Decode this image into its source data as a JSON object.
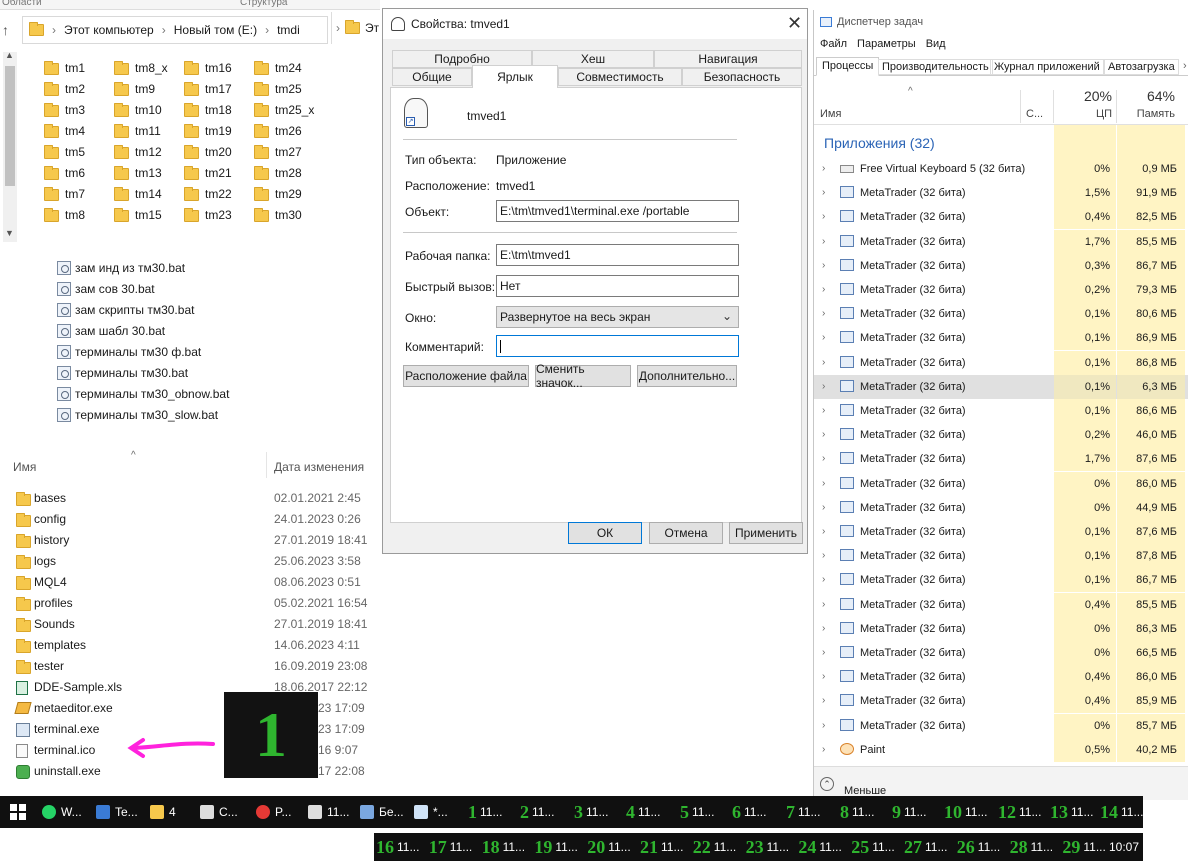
{
  "explorer": {
    "top_labels": [
      "Области",
      "Структура"
    ],
    "breadcrumb": [
      "Этот компьютер",
      "Новый том (E:)",
      "tmdi"
    ],
    "folders": [
      [
        "tm1",
        "tm8_x",
        "tm16",
        "tm24"
      ],
      [
        "tm2",
        "tm9",
        "tm17",
        "tm25"
      ],
      [
        "tm3",
        "tm10",
        "tm18",
        "tm25_x"
      ],
      [
        "tm4",
        "tm11",
        "tm19",
        "tm26"
      ],
      [
        "tm5",
        "tm12",
        "tm20",
        "tm27"
      ],
      [
        "tm6",
        "tm13",
        "tm21",
        "tm28"
      ],
      [
        "tm7",
        "tm14",
        "tm22",
        "tm29"
      ],
      [
        "tm8",
        "tm15",
        "tm23",
        "tm30"
      ]
    ],
    "bat_files": [
      "зам  инд из тм30.bat",
      "зам  сов 30.bat",
      "зам скрипты тм30.bat",
      "зам шабл 30.bat",
      "терминалы тм30 ф.bat",
      "терминалы тм30.bat",
      "терминалы тм30_obnow.bat",
      "терминалы тм30_slow.bat"
    ],
    "list_header": {
      "name": "Имя",
      "date": "Дата изменения"
    },
    "files": [
      {
        "name": "bases",
        "date": "02.01.2021 2:45",
        "kind": "folder"
      },
      {
        "name": "config",
        "date": "24.01.2023 0:26",
        "kind": "folder"
      },
      {
        "name": "history",
        "date": "27.01.2019 18:41",
        "kind": "folder"
      },
      {
        "name": "logs",
        "date": "25.06.2023 3:58",
        "kind": "folder"
      },
      {
        "name": "MQL4",
        "date": "08.06.2023 0:51",
        "kind": "folder"
      },
      {
        "name": "profiles",
        "date": "05.02.2021 16:54",
        "kind": "folder"
      },
      {
        "name": "Sounds",
        "date": "27.01.2019 18:41",
        "kind": "folder"
      },
      {
        "name": "templates",
        "date": "14.06.2023 4:11",
        "kind": "folder"
      },
      {
        "name": "tester",
        "date": "16.09.2019 23:08",
        "kind": "folder"
      },
      {
        "name": "DDE-Sample.xls",
        "date": "18.06.2017 22:12",
        "kind": "xls"
      },
      {
        "name": "metaeditor.exe",
        "date": "23 17:09",
        "kind": "me"
      },
      {
        "name": "terminal.exe",
        "date": "23 17:09",
        "kind": "exe"
      },
      {
        "name": "terminal.ico",
        "date": "16 9:07",
        "kind": "ico"
      },
      {
        "name": "uninstall.exe",
        "date": "17 22:08",
        "kind": "un"
      }
    ],
    "overlay_number": "1"
  },
  "second_window_label": "Эт",
  "dialog": {
    "title": "Свойства: tmved1",
    "tabs_row1": [
      "Подробно",
      "Хеш",
      "Навигация"
    ],
    "tabs_row2": [
      "Общие",
      "Ярлык",
      "Совместимость",
      "Безопасность"
    ],
    "shortcut_name": "tmved1",
    "labels": {
      "type": "Тип объекта:",
      "location": "Расположение:",
      "target": "Объект:",
      "workdir": "Рабочая папка:",
      "hotkey": "Быстрый вызов:",
      "window": "Окно:",
      "comment": "Комментарий:"
    },
    "values": {
      "type": "Приложение",
      "location": "tmved1",
      "target": "E:\\tm\\tmved1\\terminal.exe /portable",
      "workdir": "E:\\tm\\tmved1",
      "hotkey": "Нет",
      "window": "Развернутое на весь экран",
      "comment": ""
    },
    "buttons": {
      "open_location": "Расположение файла",
      "change_icon": "Сменить значок...",
      "advanced": "Дополнительно...",
      "ok": "ОК",
      "cancel": "Отмена",
      "apply": "Применить"
    }
  },
  "taskmgr": {
    "title": "Диспетчер задач",
    "menu": [
      "Файл",
      "Параметры",
      "Вид"
    ],
    "tabs": [
      "Процессы",
      "Производительность",
      "Журнал приложений",
      "Автозагрузка"
    ],
    "col_name": "Имя",
    "col_status": "С...",
    "cpu_pct": "20%",
    "cpu_label": "ЦП",
    "mem_pct": "64%",
    "mem_label": "Память",
    "group": "Приложения (32)",
    "processes": [
      {
        "name": "Free Virtual Keyboard 5 (32 бита)",
        "cpu": "0%",
        "mem": "0,9 МБ"
      },
      {
        "name": "MetaTrader (32 бита)",
        "cpu": "1,5%",
        "mem": "91,9 МБ"
      },
      {
        "name": "MetaTrader (32 бита)",
        "cpu": "0,4%",
        "mem": "82,5 МБ"
      },
      {
        "name": "MetaTrader (32 бита)",
        "cpu": "1,7%",
        "mem": "85,5 МБ"
      },
      {
        "name": "MetaTrader (32 бита)",
        "cpu": "0,3%",
        "mem": "86,7 МБ"
      },
      {
        "name": "MetaTrader (32 бита)",
        "cpu": "0,2%",
        "mem": "79,3 МБ"
      },
      {
        "name": "MetaTrader (32 бита)",
        "cpu": "0,1%",
        "mem": "80,6 МБ"
      },
      {
        "name": "MetaTrader (32 бита)",
        "cpu": "0,1%",
        "mem": "86,9 МБ"
      },
      {
        "name": "MetaTrader (32 бита)",
        "cpu": "0,1%",
        "mem": "86,8 МБ"
      },
      {
        "name": "MetaTrader (32 бита)",
        "cpu": "0,1%",
        "mem": "6,3 МБ"
      },
      {
        "name": "MetaTrader (32 бита)",
        "cpu": "0,1%",
        "mem": "86,6 МБ"
      },
      {
        "name": "MetaTrader (32 бита)",
        "cpu": "0,2%",
        "mem": "46,0 МБ"
      },
      {
        "name": "MetaTrader (32 бита)",
        "cpu": "1,7%",
        "mem": "87,6 МБ"
      },
      {
        "name": "MetaTrader (32 бита)",
        "cpu": "0%",
        "mem": "86,0 МБ"
      },
      {
        "name": "MetaTrader (32 бита)",
        "cpu": "0%",
        "mem": "44,9 МБ"
      },
      {
        "name": "MetaTrader (32 бита)",
        "cpu": "0,1%",
        "mem": "87,6 МБ"
      },
      {
        "name": "MetaTrader (32 бита)",
        "cpu": "0,1%",
        "mem": "87,8 МБ"
      },
      {
        "name": "MetaTrader (32 бита)",
        "cpu": "0,1%",
        "mem": "86,7 МБ"
      },
      {
        "name": "MetaTrader (32 бита)",
        "cpu": "0,4%",
        "mem": "85,5 МБ"
      },
      {
        "name": "MetaTrader (32 бита)",
        "cpu": "0%",
        "mem": "86,3 МБ"
      },
      {
        "name": "MetaTrader (32 бита)",
        "cpu": "0%",
        "mem": "66,5 МБ"
      },
      {
        "name": "MetaTrader (32 бита)",
        "cpu": "0,4%",
        "mem": "86,0 МБ"
      },
      {
        "name": "MetaTrader (32 бита)",
        "cpu": "0,4%",
        "mem": "85,9 МБ"
      },
      {
        "name": "MetaTrader (32 бита)",
        "cpu": "0%",
        "mem": "85,7 МБ"
      },
      {
        "name": "Paint",
        "cpu": "0,5%",
        "mem": "40,2 МБ"
      }
    ],
    "selected_index": 9,
    "less_label": "Меньше"
  },
  "taskbar": {
    "row1": [
      {
        "n": "",
        "t": "W..."
      },
      {
        "n": "",
        "t": "Te..."
      },
      {
        "n": "",
        "t": "4"
      },
      {
        "n": "",
        "t": "C..."
      },
      {
        "n": "",
        "t": "P..."
      },
      {
        "n": "",
        "t": "11..."
      },
      {
        "n": "",
        "t": "Бе..."
      },
      {
        "n": "",
        "t": "*..."
      },
      {
        "n": "1",
        "t": "11..."
      },
      {
        "n": "2",
        "t": "11..."
      },
      {
        "n": "3",
        "t": "11..."
      },
      {
        "n": "4",
        "t": "11..."
      },
      {
        "n": "5",
        "t": "11..."
      },
      {
        "n": "6",
        "t": "11..."
      },
      {
        "n": "7",
        "t": "11..."
      },
      {
        "n": "8",
        "t": "11..."
      },
      {
        "n": "9",
        "t": "11..."
      },
      {
        "n": "10",
        "t": "11..."
      },
      {
        "n": "12",
        "t": "11..."
      },
      {
        "n": "13",
        "t": "11..."
      },
      {
        "n": "14",
        "t": "11..."
      }
    ],
    "row2": [
      {
        "n": "16",
        "t": "11..."
      },
      {
        "n": "17",
        "t": "11..."
      },
      {
        "n": "18",
        "t": "11..."
      },
      {
        "n": "19",
        "t": "11..."
      },
      {
        "n": "20",
        "t": "11..."
      },
      {
        "n": "21",
        "t": "11..."
      },
      {
        "n": "22",
        "t": "11..."
      },
      {
        "n": "23",
        "t": "11..."
      },
      {
        "n": "24",
        "t": "11..."
      },
      {
        "n": "25",
        "t": "11..."
      },
      {
        "n": "27",
        "t": "11..."
      },
      {
        "n": "26",
        "t": "11..."
      },
      {
        "n": "28",
        "t": "11..."
      },
      {
        "n": "29",
        "t": "11..."
      }
    ],
    "clock": "10:07"
  }
}
